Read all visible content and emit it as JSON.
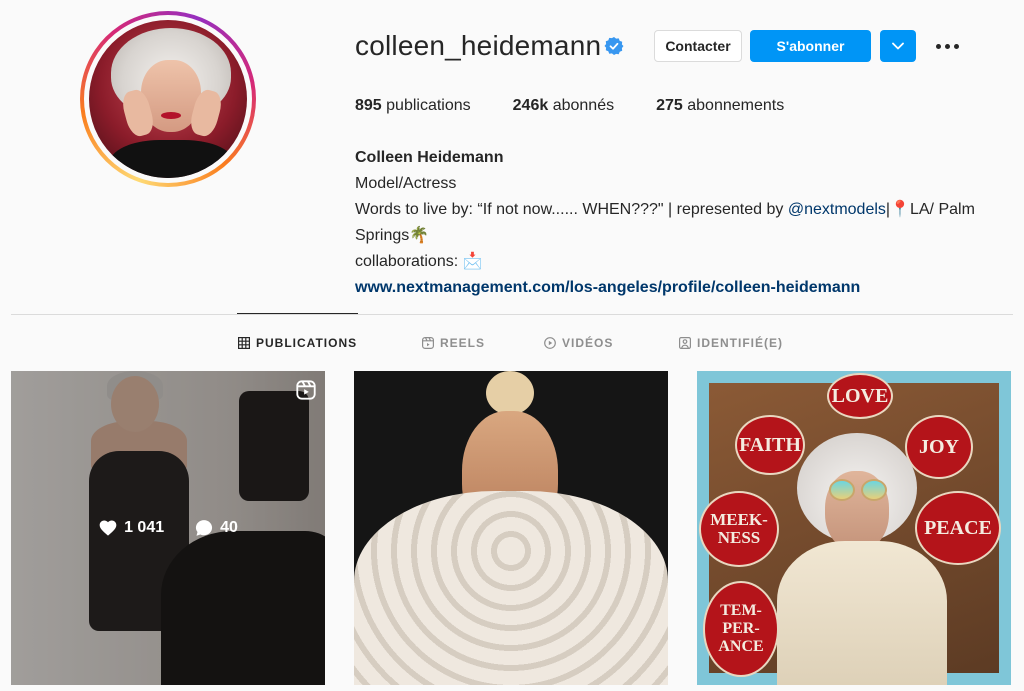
{
  "profile": {
    "username": "colleen_heidemann",
    "verified": true,
    "contact_label": "Contacter",
    "follow_label": "S'abonner",
    "stats": {
      "posts_count": "895",
      "posts_label": "publications",
      "followers_count": "246k",
      "followers_label": "abonnés",
      "following_count": "275",
      "following_label": "abonnements"
    },
    "bio": {
      "name": "Colleen Heidemann",
      "category": "Model/Actress",
      "line1_prefix": "Words to live by: “If not now...... WHEN???\" | represented by ",
      "mention": "@nextmodels",
      "line1_suffix": "|📍LA/ Palm Springs🌴",
      "line2": "collaborations: 📩",
      "link": "www.nextmanagement.com/los-angeles/profile/colleen-heidemann"
    }
  },
  "tabs": [
    {
      "label": "PUBLICATIONS",
      "icon": "grid-icon",
      "active": true
    },
    {
      "label": "REELS",
      "icon": "reels-icon",
      "active": false
    },
    {
      "label": "VIDÉOS",
      "icon": "play-icon",
      "active": false
    },
    {
      "label": "IDENTIFIÉ(E)",
      "icon": "tagged-icon",
      "active": false
    }
  ],
  "posts": [
    {
      "type": "reel",
      "likes": "1 041",
      "comments": "40",
      "hovered": true
    },
    {
      "type": "photo"
    },
    {
      "type": "photo",
      "signs": [
        "LOVE",
        "FAITH",
        "JOY",
        "MEEK-NESS",
        "PEACE",
        "TEM-PER-ANCE"
      ]
    }
  ],
  "colors": {
    "accent": "#0095f6",
    "link": "#00376b",
    "text": "#262626",
    "muted": "#8e8e8e"
  }
}
